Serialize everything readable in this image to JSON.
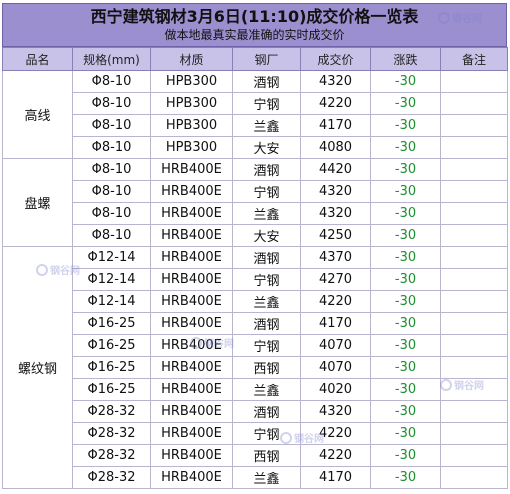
{
  "header": {
    "title": "西宁建筑钢材3月6日(11:10)成交价格一览表",
    "subtitle": "做本地最真实最准确的实时成交价"
  },
  "columns": [
    "品名",
    "规格(mm)",
    "材质",
    "钢厂",
    "成交价",
    "涨跌",
    "备注"
  ],
  "groups": [
    {
      "category": "高线",
      "rows": [
        {
          "spec": "Φ8-10",
          "material": "HPB300",
          "mill": "酒钢",
          "price": "4320",
          "change": "-30",
          "note": ""
        },
        {
          "spec": "Φ8-10",
          "material": "HPB300",
          "mill": "宁钢",
          "price": "4220",
          "change": "-30",
          "note": ""
        },
        {
          "spec": "Φ8-10",
          "material": "HPB300",
          "mill": "兰鑫",
          "price": "4170",
          "change": "-30",
          "note": ""
        },
        {
          "spec": "Φ8-10",
          "material": "HPB300",
          "mill": "大安",
          "price": "4080",
          "change": "-30",
          "note": ""
        }
      ]
    },
    {
      "category": "盘螺",
      "rows": [
        {
          "spec": "Φ8-10",
          "material": "HRB400E",
          "mill": "酒钢",
          "price": "4420",
          "change": "-30",
          "note": ""
        },
        {
          "spec": "Φ8-10",
          "material": "HRB400E",
          "mill": "宁钢",
          "price": "4320",
          "change": "-30",
          "note": ""
        },
        {
          "spec": "Φ8-10",
          "material": "HRB400E",
          "mill": "兰鑫",
          "price": "4320",
          "change": "-30",
          "note": ""
        },
        {
          "spec": "Φ8-10",
          "material": "HRB400E",
          "mill": "大安",
          "price": "4250",
          "change": "-30",
          "note": ""
        }
      ]
    },
    {
      "category": "螺纹钢",
      "rows": [
        {
          "spec": "Φ12-14",
          "material": "HRB400E",
          "mill": "酒钢",
          "price": "4370",
          "change": "-30",
          "note": ""
        },
        {
          "spec": "Φ12-14",
          "material": "HRB400E",
          "mill": "宁钢",
          "price": "4270",
          "change": "-30",
          "note": ""
        },
        {
          "spec": "Φ12-14",
          "material": "HRB400E",
          "mill": "兰鑫",
          "price": "4220",
          "change": "-30",
          "note": ""
        },
        {
          "spec": "Φ16-25",
          "material": "HRB400E",
          "mill": "酒钢",
          "price": "4170",
          "change": "-30",
          "note": ""
        },
        {
          "spec": "Φ16-25",
          "material": "HRB400E",
          "mill": "宁钢",
          "price": "4070",
          "change": "-30",
          "note": ""
        },
        {
          "spec": "Φ16-25",
          "material": "HRB400E",
          "mill": "西钢",
          "price": "4070",
          "change": "-30",
          "note": ""
        },
        {
          "spec": "Φ16-25",
          "material": "HRB400E",
          "mill": "兰鑫",
          "price": "4020",
          "change": "-30",
          "note": ""
        },
        {
          "spec": "Φ28-32",
          "material": "HRB400E",
          "mill": "酒钢",
          "price": "4320",
          "change": "-30",
          "note": ""
        },
        {
          "spec": "Φ28-32",
          "material": "HRB400E",
          "mill": "宁钢",
          "price": "4220",
          "change": "-30",
          "note": ""
        },
        {
          "spec": "Φ28-32",
          "material": "HRB400E",
          "mill": "西钢",
          "price": "4220",
          "change": "-30",
          "note": ""
        },
        {
          "spec": "Φ28-32",
          "material": "HRB400E",
          "mill": "兰鑫",
          "price": "4170",
          "change": "-30",
          "note": ""
        }
      ]
    }
  ],
  "watermark": "钢谷网",
  "colors": {
    "header_bg": "#9c8fcf",
    "column_header_bg": "#c9c2e8",
    "change_text": "#1a8f2e"
  }
}
